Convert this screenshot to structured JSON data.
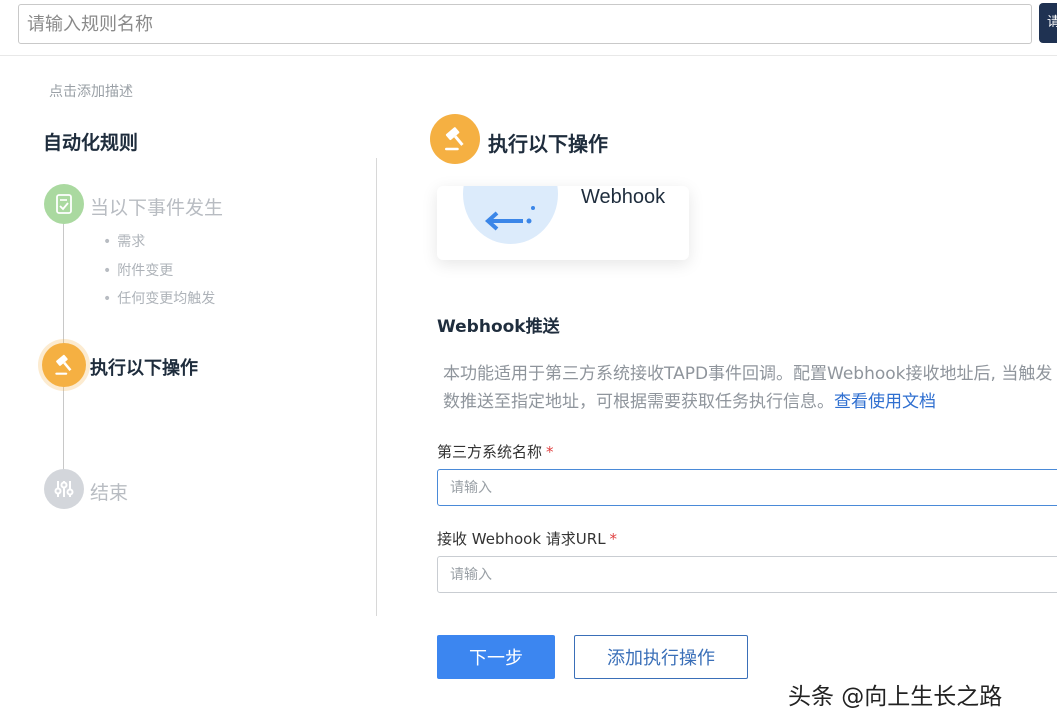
{
  "header": {
    "rule_name_placeholder": "请输入规则名称",
    "tooltip_text": "请"
  },
  "description_link": "点击添加描述",
  "sidebar": {
    "title": "自动化规则",
    "steps": [
      {
        "label": "当以下事件发生",
        "state": "inactive",
        "color": "#aad9a0",
        "icon": "document-check-icon",
        "items": [
          "需求",
          "附件变更",
          "任何变更均触发"
        ]
      },
      {
        "label": "执行以下操作",
        "state": "active",
        "color": "#f5b042",
        "icon": "gavel-icon"
      },
      {
        "label": "结束",
        "state": "inactive",
        "color": "#d3d6db",
        "icon": "sliders-icon"
      }
    ]
  },
  "main": {
    "header_title": "执行以下操作",
    "header_icon": "gavel-icon",
    "action_card": {
      "label": "Webhook",
      "icon": "webhook-arrow-icon"
    },
    "section_title": "Webhook推送",
    "description_line1": "本功能适用于第三方系统接收TAPD事件回调。配置Webhook接收地址后, 当触发",
    "description_line2": "数推送至指定地址，可根据需要获取任务执行信息。",
    "doc_link": "查看使用文档",
    "fields": [
      {
        "label": "第三方系统名称",
        "required_mark": "*",
        "placeholder": "请输入",
        "value": ""
      },
      {
        "label": "接收 Webhook 请求URL",
        "required_mark": "*",
        "placeholder": "请输入",
        "value": ""
      }
    ],
    "buttons": {
      "next": "下一步",
      "add_action": "添加执行操作"
    }
  },
  "watermark": "头条 @向上生长之路",
  "colors": {
    "primary": "#3c86f0",
    "active_step": "#f5b042",
    "link": "#2f6fd0"
  }
}
